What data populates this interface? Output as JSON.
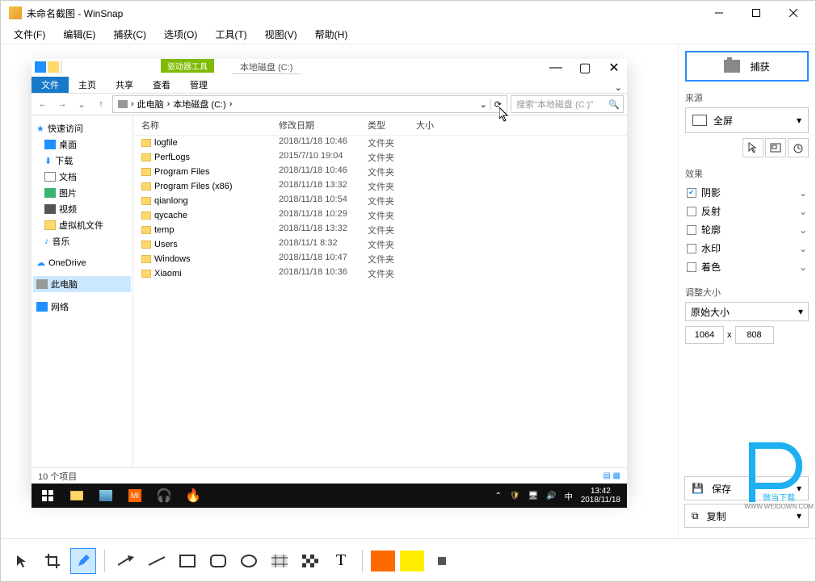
{
  "window": {
    "title": "未命名截图 - WinSnap"
  },
  "menu": {
    "file": "文件(F)",
    "edit": "编辑(E)",
    "capture": "捕获(C)",
    "options": "选项(O)",
    "tools": "工具(T)",
    "view": "视图(V)",
    "help": "帮助(H)"
  },
  "side": {
    "capture": "捕获",
    "source_label": "来源",
    "source_value": "全屏",
    "effects_label": "效果",
    "effects": {
      "shadow": "阴影",
      "reflect": "反射",
      "outline": "轮廓",
      "watermark": "水印",
      "colorize": "着色"
    },
    "resize_label": "调整大小",
    "resize_value": "原始大小",
    "width": "1064",
    "height": "808",
    "x": "x",
    "save": "保存",
    "copy": "复制"
  },
  "explorer": {
    "tool_tab": "驱动器工具",
    "location_tab": "本地磁盘 (C:)",
    "tabs": {
      "file": "文件",
      "home": "主页",
      "share": "共享",
      "view": "查看",
      "manage": "管理"
    },
    "path": {
      "pc": "此电脑",
      "drive": "本地磁盘 (C:)"
    },
    "search_placeholder": "搜索\"本地磁盘 (C:)\"",
    "columns": {
      "name": "名称",
      "date": "修改日期",
      "type": "类型",
      "size": "大小"
    },
    "rows": [
      {
        "name": "logfile",
        "date": "2018/11/18 10:46",
        "type": "文件夹"
      },
      {
        "name": "PerfLogs",
        "date": "2015/7/10 19:04",
        "type": "文件夹"
      },
      {
        "name": "Program Files",
        "date": "2018/11/18 10:46",
        "type": "文件夹"
      },
      {
        "name": "Program Files (x86)",
        "date": "2018/11/18 13:32",
        "type": "文件夹"
      },
      {
        "name": "qianlong",
        "date": "2018/11/18 10:54",
        "type": "文件夹"
      },
      {
        "name": "qycache",
        "date": "2018/11/18 10:29",
        "type": "文件夹"
      },
      {
        "name": "temp",
        "date": "2018/11/18 13:32",
        "type": "文件夹"
      },
      {
        "name": "Users",
        "date": "2018/11/1 8:32",
        "type": "文件夹"
      },
      {
        "name": "Windows",
        "date": "2018/11/18 10:47",
        "type": "文件夹"
      },
      {
        "name": "Xiaomi",
        "date": "2018/11/18 10:36",
        "type": "文件夹"
      }
    ],
    "status": "10 个项目",
    "nav": {
      "quick": "快速访问",
      "desktop": "桌面",
      "downloads": "下载",
      "documents": "文档",
      "pictures": "图片",
      "videos": "视频",
      "vm": "虚拟机文件",
      "music": "音乐",
      "onedrive": "OneDrive",
      "thispc": "此电脑",
      "network": "网络"
    },
    "clock": {
      "time": "13:42",
      "date": "2018/11/18"
    }
  },
  "watermark": {
    "line1": "微当下载",
    "line2": "WWW.WEIDOWN.COM"
  }
}
